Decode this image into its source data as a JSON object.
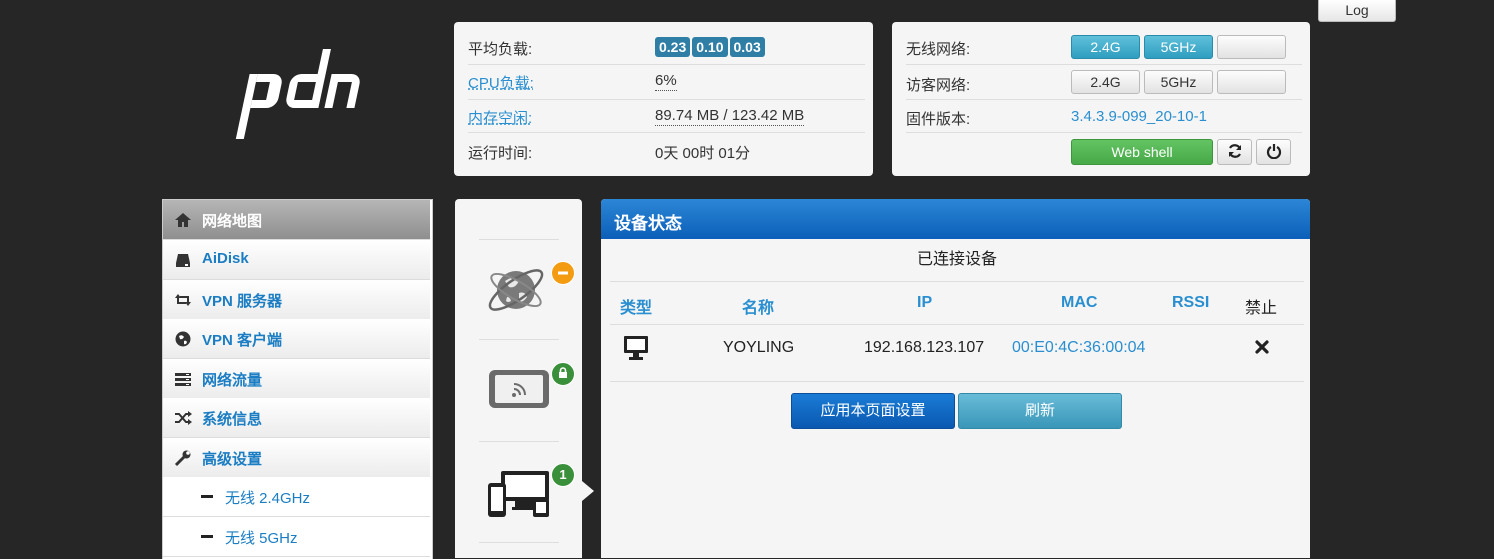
{
  "header": {
    "log_label": "Log"
  },
  "system": {
    "load_label": "平均负载:",
    "load_values": [
      "0.23",
      "0.10",
      "0.03"
    ],
    "cpu_label": "CPU负载:",
    "cpu_value": "6%",
    "mem_label": "内存空闲:",
    "mem_value": "89.74 MB / 123.42 MB",
    "uptime_label": "运行时间:",
    "uptime_value": "0天 00时 01分"
  },
  "wireless": {
    "wifi_label": "无线网络:",
    "guest_label": "访客网络:",
    "band_24": "2.4G",
    "band_5": "5GHz",
    "firmware_label": "固件版本:",
    "firmware_value": "3.4.3.9-099_20-10-1",
    "webshell_label": "Web shell"
  },
  "sidebar": {
    "items": [
      {
        "label": "网络地图",
        "icon": "home-icon"
      },
      {
        "label": "AiDisk",
        "icon": "disk-icon"
      },
      {
        "label": "VPN 服务器",
        "icon": "retweet-icon"
      },
      {
        "label": "VPN 客户端",
        "icon": "globe-icon"
      },
      {
        "label": "网络流量",
        "icon": "tasks-icon"
      },
      {
        "label": "系统信息",
        "icon": "random-icon"
      },
      {
        "label": "高级设置",
        "icon": "wrench-icon"
      }
    ],
    "sub_items": [
      {
        "label": "无线 2.4GHz"
      },
      {
        "label": "无线 5GHz"
      }
    ]
  },
  "devices": {
    "client_count": "1"
  },
  "main": {
    "title": "设备状态",
    "subtitle": "已连接设备",
    "columns": [
      "类型",
      "名称",
      "IP",
      "MAC",
      "RSSI",
      "禁止"
    ],
    "rows": [
      {
        "name": "YOYLING",
        "ip": "192.168.123.107",
        "mac": "00:E0:4C:36:00:04",
        "rssi": ""
      }
    ],
    "apply_label": "应用本页面设置",
    "refresh_label": "刷新"
  },
  "colors": {
    "accent_blue": "#2a8fd0",
    "header_blue": "#0b5fb8",
    "badge_orange": "#f39c12",
    "badge_green": "#3a8f3a"
  }
}
